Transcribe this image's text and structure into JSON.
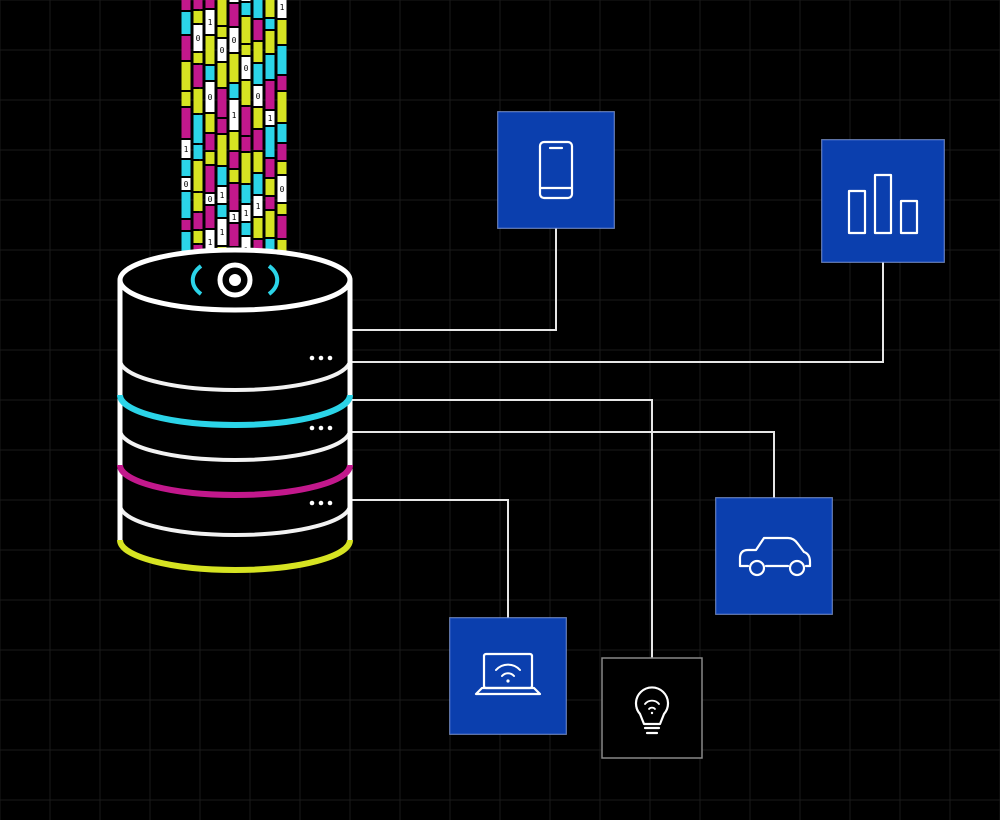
{
  "diagram": {
    "background": "#000000",
    "grid_color": "#1a1a1a",
    "database": {
      "name": "database-cylinder",
      "body_stroke": "#ffffff",
      "band_colors": [
        "#2bd4e8",
        "#c2188c",
        "#d6e322"
      ],
      "sensor_ring_color": "#2bd4e8",
      "dot_color": "#ffffff"
    },
    "data_stream": {
      "name": "data-stream",
      "palette": [
        "#c2188c",
        "#2bd4e8",
        "#d6e322",
        "#ffffff"
      ],
      "binary_glyphs": [
        "1",
        "0",
        "0",
        "0",
        "1",
        "1",
        "0",
        "0",
        "1",
        "0",
        "1",
        "1",
        "0",
        "0",
        "0",
        "1"
      ]
    },
    "connectors": {
      "color": "#e6e6e6"
    },
    "nodes": [
      {
        "id": "phone",
        "label": "smartphone-icon",
        "style": "filled",
        "bg": "#0b3fae",
        "stroke": "#ffffff"
      },
      {
        "id": "chart",
        "label": "bar-chart-icon",
        "style": "filled",
        "bg": "#0b3fae",
        "stroke": "#ffffff"
      },
      {
        "id": "car",
        "label": "car-icon",
        "style": "filled",
        "bg": "#0b3fae",
        "stroke": "#ffffff"
      },
      {
        "id": "laptop",
        "label": "laptop-wifi-icon",
        "style": "filled",
        "bg": "#0b3fae",
        "stroke": "#ffffff"
      },
      {
        "id": "lightbulb",
        "label": "smart-bulb-icon",
        "style": "outline",
        "bg": "#000000",
        "stroke": "#888888"
      }
    ]
  }
}
